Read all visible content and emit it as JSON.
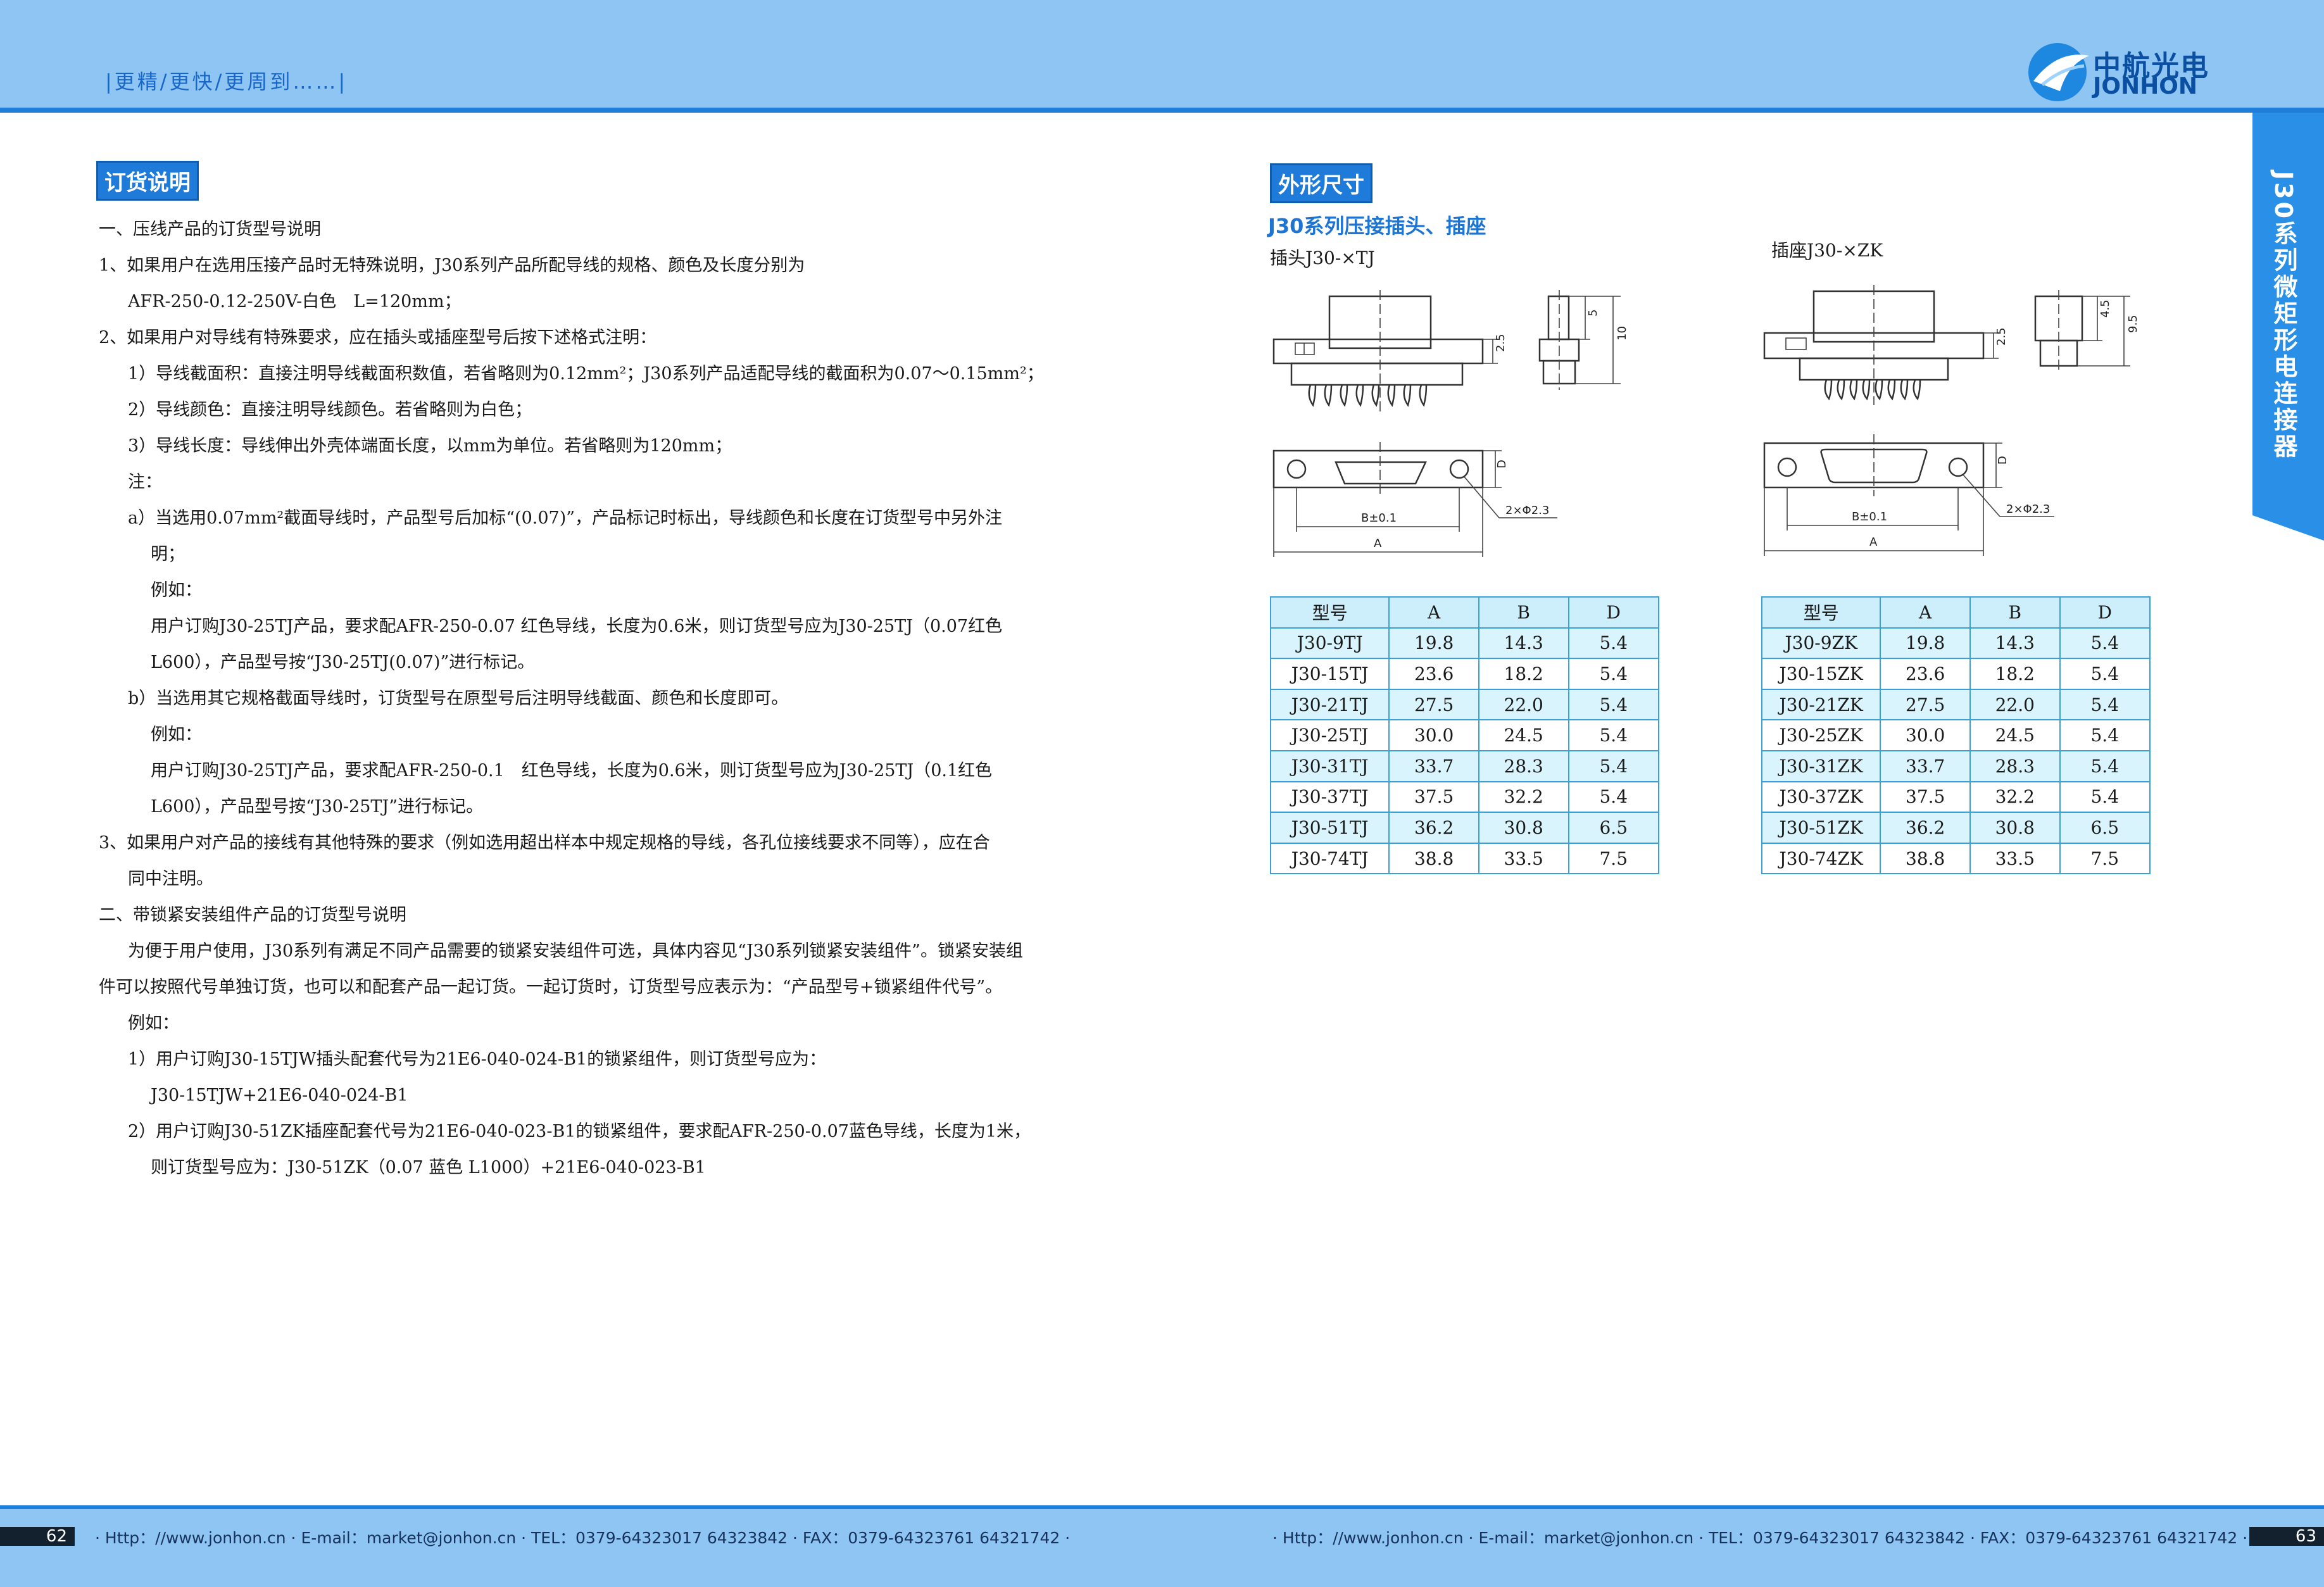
{
  "header": {
    "slogan": "|更精/更快/更周到……|",
    "logo_cn": "中航光电",
    "logo_en": "JONHON",
    "side_tab": "J30系列微矩形电连接器"
  },
  "left": {
    "section_tag": "订货说明",
    "lines": [
      "一、压线产品的订货型号说明",
      "1、如果用户在选用压接产品时无特殊说明，J30系列产品所配导线的规格、颜色及长度分别为",
      "AFR-250-0.12-250V-白色　L=120mm；",
      "2、如果用户对导线有特殊要求，应在插头或插座型号后按下述格式注明：",
      "1）导线截面积：直接注明导线截面积数值，若省略则为0.12mm²；J30系列产品适配导线的截面积为0.07～0.15mm²；",
      "2）导线颜色：直接注明导线颜色。若省略则为白色；",
      "3）导线长度：导线伸出外壳体端面长度，以mm为单位。若省略则为120mm；",
      "注：",
      "a）当选用0.07mm²截面导线时，产品型号后加标“(0.07)”，产品标记时标出，导线颜色和长度在订货型号中另外注",
      "明；",
      "例如：",
      "用户订购J30-25TJ产品，要求配AFR-250-0.07 红色导线，长度为0.6米，则订货型号应为J30-25TJ（0.07红色",
      "L600），产品型号按“J30-25TJ(0.07)”进行标记。",
      "b）当选用其它规格截面导线时，订货型号在原型号后注明导线截面、颜色和长度即可。",
      "例如：",
      "用户订购J30-25TJ产品，要求配AFR-250-0.1　红色导线，长度为0.6米，则订货型号应为J30-25TJ（0.1红色",
      "L600），产品型号按“J30-25TJ”进行标记。",
      "3、如果用户对产品的接线有其他特殊的要求（例如选用超出样本中规定规格的导线，各孔位接线要求不同等），应在合",
      "同中注明。",
      "二、带锁紧安装组件产品的订货型号说明",
      "为便于用户使用，J30系列有满足不同产品需要的锁紧安装组件可选，具体内容见“J30系列锁紧安装组件”。锁紧安装组",
      "件可以按照代号单独订货，也可以和配套产品一起订货。一起订货时，订货型号应表示为：“产品型号+锁紧组件代号”。",
      "例如：",
      "1）用户订购J30-15TJW插头配套代号为21E6-040-024-B1的锁紧组件，则订货型号应为：",
      "J30-15TJW+21E6-040-024-B1",
      "2）用户订购J30-51ZK插座配套代号为21E6-040-023-B1的锁紧组件，要求配AFR-250-0.07蓝色导线，长度为1米，",
      "则订货型号应为：J30-51ZK（0.07 蓝色 L1000）+21E6-040-023-B1"
    ]
  },
  "right": {
    "section_tag": "外形尺寸",
    "subtitle": "J30系列压接插头、插座",
    "plug_label": "插头J30-×TJ",
    "socket_label": "插座J30-×ZK",
    "dims": {
      "d1": "2.5",
      "d2": "5",
      "d3": "10",
      "d4": "4.5",
      "d5": "9.5",
      "D": "D",
      "B": "B±0.1",
      "A": "A",
      "holes": "2×Φ2.3"
    },
    "headers": [
      "型号",
      "A",
      "B",
      "D"
    ],
    "plug_rows": [
      [
        "J30-9TJ",
        "19.8",
        "14.3",
        "5.4"
      ],
      [
        "J30-15TJ",
        "23.6",
        "18.2",
        "5.4"
      ],
      [
        "J30-21TJ",
        "27.5",
        "22.0",
        "5.4"
      ],
      [
        "J30-25TJ",
        "30.0",
        "24.5",
        "5.4"
      ],
      [
        "J30-31TJ",
        "33.7",
        "28.3",
        "5.4"
      ],
      [
        "J30-37TJ",
        "37.5",
        "32.2",
        "5.4"
      ],
      [
        "J30-51TJ",
        "36.2",
        "30.8",
        "6.5"
      ],
      [
        "J30-74TJ",
        "38.8",
        "33.5",
        "7.5"
      ]
    ],
    "socket_rows": [
      [
        "J30-9ZK",
        "19.8",
        "14.3",
        "5.4"
      ],
      [
        "J30-15ZK",
        "23.6",
        "18.2",
        "5.4"
      ],
      [
        "J30-21ZK",
        "27.5",
        "22.0",
        "5.4"
      ],
      [
        "J30-25ZK",
        "30.0",
        "24.5",
        "5.4"
      ],
      [
        "J30-31ZK",
        "33.7",
        "28.3",
        "5.4"
      ],
      [
        "J30-37ZK",
        "37.5",
        "32.2",
        "5.4"
      ],
      [
        "J30-51ZK",
        "36.2",
        "30.8",
        "6.5"
      ],
      [
        "J30-74ZK",
        "38.8",
        "33.5",
        "7.5"
      ]
    ]
  },
  "footer": {
    "page_left": "62",
    "page_right": "63",
    "contact": "· Http：//www.jonhon.cn · E-mail：market@jonhon.cn · TEL：0379-64323017 64323842 · FAX：0379-64323761 64321742 ·"
  },
  "colors": {
    "header_bg": "#8fc5f2",
    "accent": "#1e7bd9",
    "table_border": "#3b9fd8",
    "table_fill": "#d9f4fc"
  }
}
